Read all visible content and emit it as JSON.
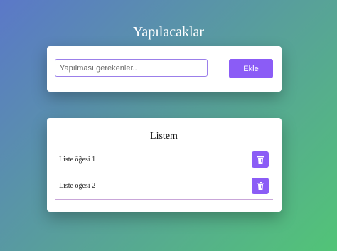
{
  "app": {
    "title": "Yapılacaklar"
  },
  "input_card": {
    "placeholder": "Yapılması gerekenler..",
    "value": "",
    "add_label": "Ekle"
  },
  "list": {
    "title": "Listem",
    "items": [
      {
        "label": "Liste öğesi 1",
        "action_icon": "trash-icon"
      },
      {
        "label": "Liste öğesi 2",
        "action_icon": "trash-icon"
      }
    ]
  },
  "colors": {
    "accent": "#8b5cf6",
    "background_start": "#5b78c8",
    "background_end": "#52c477",
    "item_border": "#c9a6d9"
  }
}
